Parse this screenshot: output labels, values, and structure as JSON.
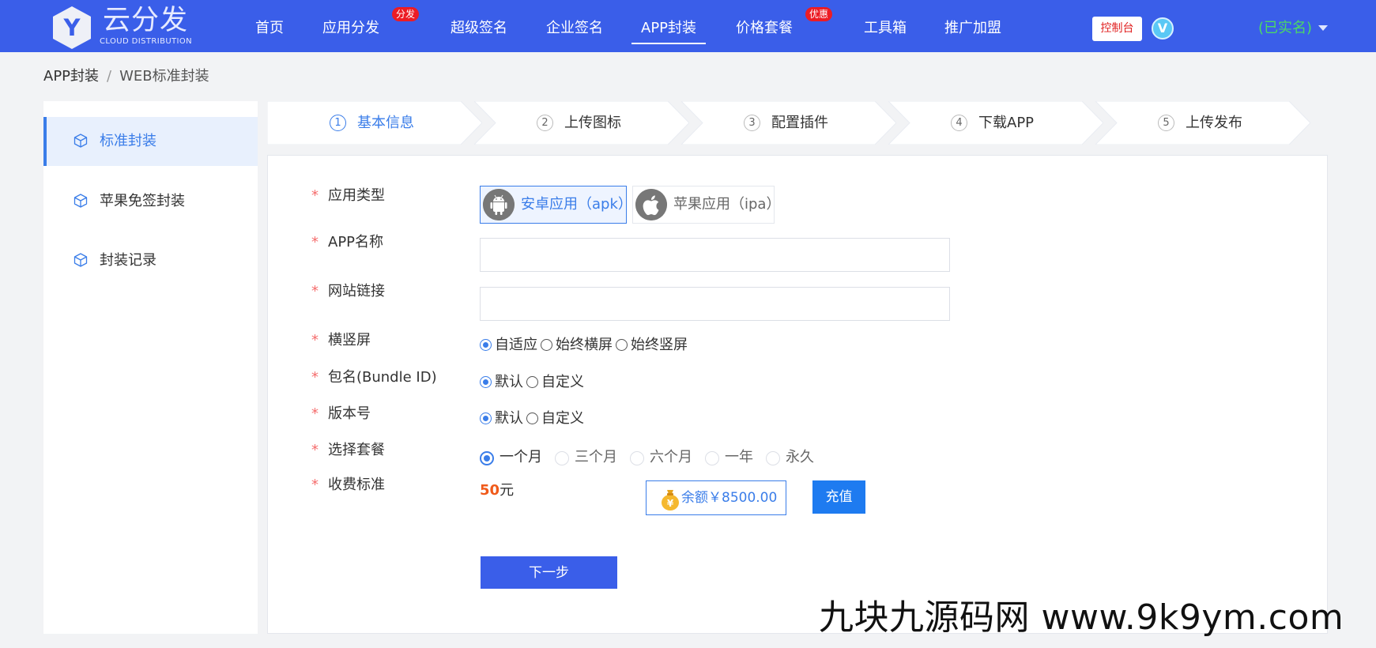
{
  "logo": {
    "letter": "Y",
    "name": "云分发",
    "subtitle": "CLOUD DISTRIBUTION"
  },
  "nav": {
    "items": [
      {
        "label": "首页"
      },
      {
        "label": "应用分发",
        "badge": "分发"
      },
      {
        "label": "超级签名"
      },
      {
        "label": "企业签名"
      },
      {
        "label": "APP封装",
        "active": true
      },
      {
        "label": "价格套餐",
        "badge": "优惠"
      },
      {
        "label": "工具箱"
      },
      {
        "label": "推广加盟"
      }
    ],
    "console_label": "控制台",
    "vip_letter": "V",
    "user_status": "(已实名)"
  },
  "breadcrumb": {
    "root": "APP封装",
    "separator": "/",
    "current": "WEB标准封装"
  },
  "sidebar": {
    "items": [
      {
        "label": "标准封装",
        "active": true
      },
      {
        "label": "苹果免签封装"
      },
      {
        "label": "封装记录"
      }
    ]
  },
  "steps": [
    {
      "num": "1",
      "label": "基本信息",
      "active": true
    },
    {
      "num": "2",
      "label": "上传图标"
    },
    {
      "num": "3",
      "label": "配置插件"
    },
    {
      "num": "4",
      "label": "下载APP"
    },
    {
      "num": "5",
      "label": "上传发布"
    }
  ],
  "form": {
    "required_mark": "*",
    "app_type": {
      "label": "应用类型",
      "options": [
        {
          "label": "安卓应用（apk）",
          "icon": "android-icon",
          "selected": true
        },
        {
          "label": "苹果应用（ipa）",
          "icon": "apple-icon"
        }
      ]
    },
    "app_name": {
      "label": "APP名称",
      "value": "",
      "placeholder": ""
    },
    "site_url": {
      "label": "网站链接",
      "value": "",
      "placeholder": ""
    },
    "orientation": {
      "label": "横竖屏",
      "options": [
        "自适应",
        "始终横屏",
        "始终竖屏"
      ],
      "selected": 0
    },
    "bundle_id": {
      "label": "包名(Bundle ID)",
      "options": [
        "默认",
        "自定义"
      ],
      "selected": 0
    },
    "version": {
      "label": "版本号",
      "options": [
        "默认",
        "自定义"
      ],
      "selected": 0
    },
    "plan": {
      "label": "选择套餐",
      "options": [
        "一个月",
        "三个月",
        "六个月",
        "一年",
        "永久"
      ],
      "selected": 0
    },
    "fee": {
      "label": "收费标准",
      "amount": "50",
      "unit": "元"
    },
    "balance": {
      "text": "余额￥8500.00",
      "icon": "moneybag-icon"
    },
    "recharge_label": "充值",
    "next_label": "下一步"
  },
  "watermark": "九块九源码网 www.9k9ym.com",
  "colors": {
    "primary": "#3a5ee9",
    "accent": "#3a7de9",
    "required": "#f56c6c",
    "price": "#f05a1a",
    "verified": "#4cd964"
  }
}
